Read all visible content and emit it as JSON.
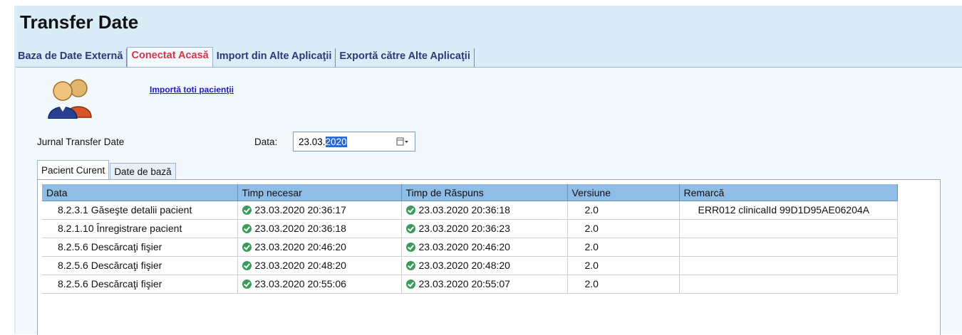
{
  "page": {
    "title": "Transfer Date"
  },
  "top_tabs": [
    {
      "label": "Baza de Date Externă",
      "active": false
    },
    {
      "label": "Conectat Acasă",
      "active": true
    },
    {
      "label": "Import din Alte Aplicaţii",
      "active": false
    },
    {
      "label": "Exportă către Alte Aplicaţii",
      "active": false
    }
  ],
  "panel": {
    "import_link": "Importă toti pacienţii",
    "avatar_icon": "users-icon",
    "journal_label": "Jurnal Transfer Date",
    "date_label": "Data:",
    "date_value_prefix": "23.03.",
    "date_value_selected": "2020",
    "date_picker_icon": "calendar-dropdown-icon"
  },
  "sub_tabs": [
    {
      "label": "Pacient Curent",
      "active": true
    },
    {
      "label": "Date de bază",
      "active": false
    }
  ],
  "grid": {
    "columns": [
      "Data",
      "Timp necesar",
      "Timp de Răspuns",
      "Versiune",
      "Remarcă"
    ],
    "rows": [
      {
        "data": "8.2.3.1 Găseşte detalii pacient",
        "timp_necesar": "23.03.2020 20:36:17",
        "timp_raspuns": "23.03.2020 20:36:18",
        "versiune": "2.0",
        "remarca": "ERR012 clinicalId 99D1D95AE06204A"
      },
      {
        "data": "8.2.1.10 Înregistrare pacient",
        "timp_necesar": "23.03.2020 20:36:18",
        "timp_raspuns": "23.03.2020 20:36:23",
        "versiune": "2.0",
        "remarca": ""
      },
      {
        "data": "8.2.5.6 Descărcaţi fişier",
        "timp_necesar": "23.03.2020 20:46:20",
        "timp_raspuns": "23.03.2020 20:46:20",
        "versiune": "2.0",
        "remarca": ""
      },
      {
        "data": "8.2.5.6 Descărcaţi fişier",
        "timp_necesar": "23.03.2020 20:48:20",
        "timp_raspuns": "23.03.2020 20:48:20",
        "versiune": "2.0",
        "remarca": ""
      },
      {
        "data": "8.2.5.6 Descărcaţi fişier",
        "timp_necesar": "23.03.2020 20:55:06",
        "timp_raspuns": "23.03.2020 20:55:07",
        "versiune": "2.0",
        "remarca": ""
      }
    ]
  },
  "colors": {
    "background": "#d9ecf8",
    "active_tab_text": "#d5344d",
    "tab_text": "#2b3a78",
    "grid_header": "#8fbde6",
    "status_ok": "#3a9a5a",
    "link": "#1a1ad8"
  }
}
